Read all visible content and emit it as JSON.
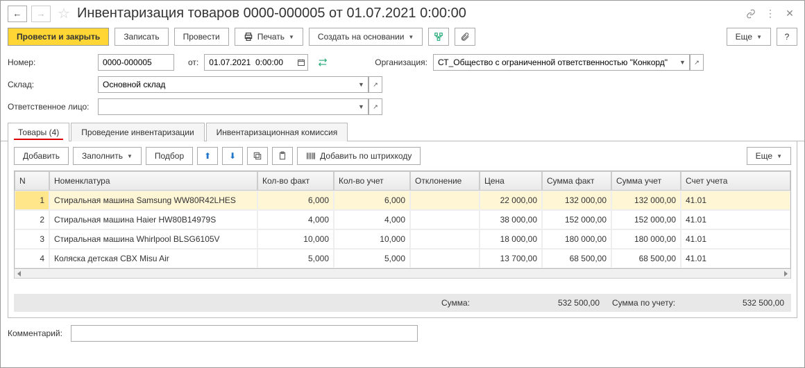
{
  "header": {
    "title": "Инвентаризация товаров 0000-000005 от 01.07.2021 0:00:00"
  },
  "toolbar": {
    "post_close": "Провести и закрыть",
    "save": "Записать",
    "post": "Провести",
    "print": "Печать",
    "create_based": "Создать на основании",
    "more": "Еще",
    "help": "?"
  },
  "form": {
    "number_label": "Номер:",
    "number_value": "0000-000005",
    "from_label": "от:",
    "date_value": "01.07.2021  0:00:00",
    "org_label": "Организация:",
    "org_value": "СТ_Общество с ограниченной ответственностью \"Конкорд\"",
    "warehouse_label": "Склад:",
    "warehouse_value": "Основной склад",
    "responsible_label": "Ответственное лицо:",
    "responsible_value": "",
    "comment_label": "Комментарий:",
    "comment_value": ""
  },
  "tabs": {
    "goods": "Товары (4)",
    "inventory": "Проведение инвентаризации",
    "committee": "Инвентаризационная комиссия"
  },
  "subtoolbar": {
    "add": "Добавить",
    "fill": "Заполнить",
    "pick": "Подбор",
    "add_barcode": "Добавить по штрихкоду",
    "more": "Еще"
  },
  "grid": {
    "columns": {
      "n": "N",
      "nomen": "Номенклатура",
      "qty_fact": "Кол-во факт",
      "qty_acc": "Кол-во учет",
      "delta": "Отклонение",
      "price": "Цена",
      "sum_fact": "Сумма факт",
      "sum_acc": "Сумма учет",
      "account": "Счет учета"
    },
    "rows": [
      {
        "n": "1",
        "nomen": "Стиральная машина Samsung WW80R42LHES",
        "qty_fact": "6,000",
        "qty_acc": "6,000",
        "delta": "",
        "price": "22 000,00",
        "sum_fact": "132 000,00",
        "sum_acc": "132 000,00",
        "account": "41.01"
      },
      {
        "n": "2",
        "nomen": "Стиральная машина Haier HW80B14979S",
        "qty_fact": "4,000",
        "qty_acc": "4,000",
        "delta": "",
        "price": "38 000,00",
        "sum_fact": "152 000,00",
        "sum_acc": "152 000,00",
        "account": "41.01"
      },
      {
        "n": "3",
        "nomen": "Стиральная машина Whirlpool BLSG6105V",
        "qty_fact": "10,000",
        "qty_acc": "10,000",
        "delta": "",
        "price": "18 000,00",
        "sum_fact": "180 000,00",
        "sum_acc": "180 000,00",
        "account": "41.01"
      },
      {
        "n": "4",
        "nomen": "Коляска детская CBX Misu Air",
        "qty_fact": "5,000",
        "qty_acc": "5,000",
        "delta": "",
        "price": "13 700,00",
        "sum_fact": "68 500,00",
        "sum_acc": "68 500,00",
        "account": "41.01"
      }
    ]
  },
  "totals": {
    "sum_label": "Сумма:",
    "sum_value": "532 500,00",
    "sum_acc_label": "Сумма по учету:",
    "sum_acc_value": "532 500,00"
  }
}
